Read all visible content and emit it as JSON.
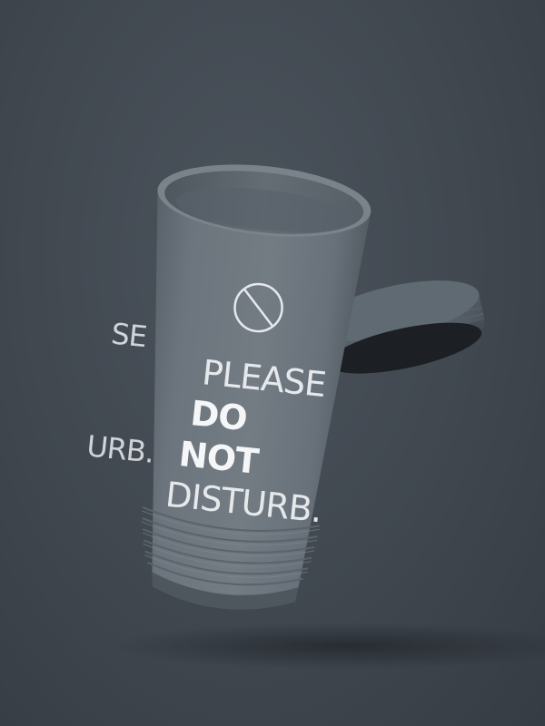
{
  "cup_print": {
    "line1": "PLEASE",
    "line2": "DO",
    "line3": "NOT",
    "line4": "DISTURB.",
    "wrap_line1": "SE",
    "wrap_line4": "URB."
  },
  "icons": {
    "print_symbol": "no-entry-circle-icon"
  },
  "colors": {
    "background": "#40474f",
    "cup_body": "#6c757c",
    "cup_inside": "#5e676e",
    "lid": "#59636a",
    "print": "#e6e9ec"
  }
}
